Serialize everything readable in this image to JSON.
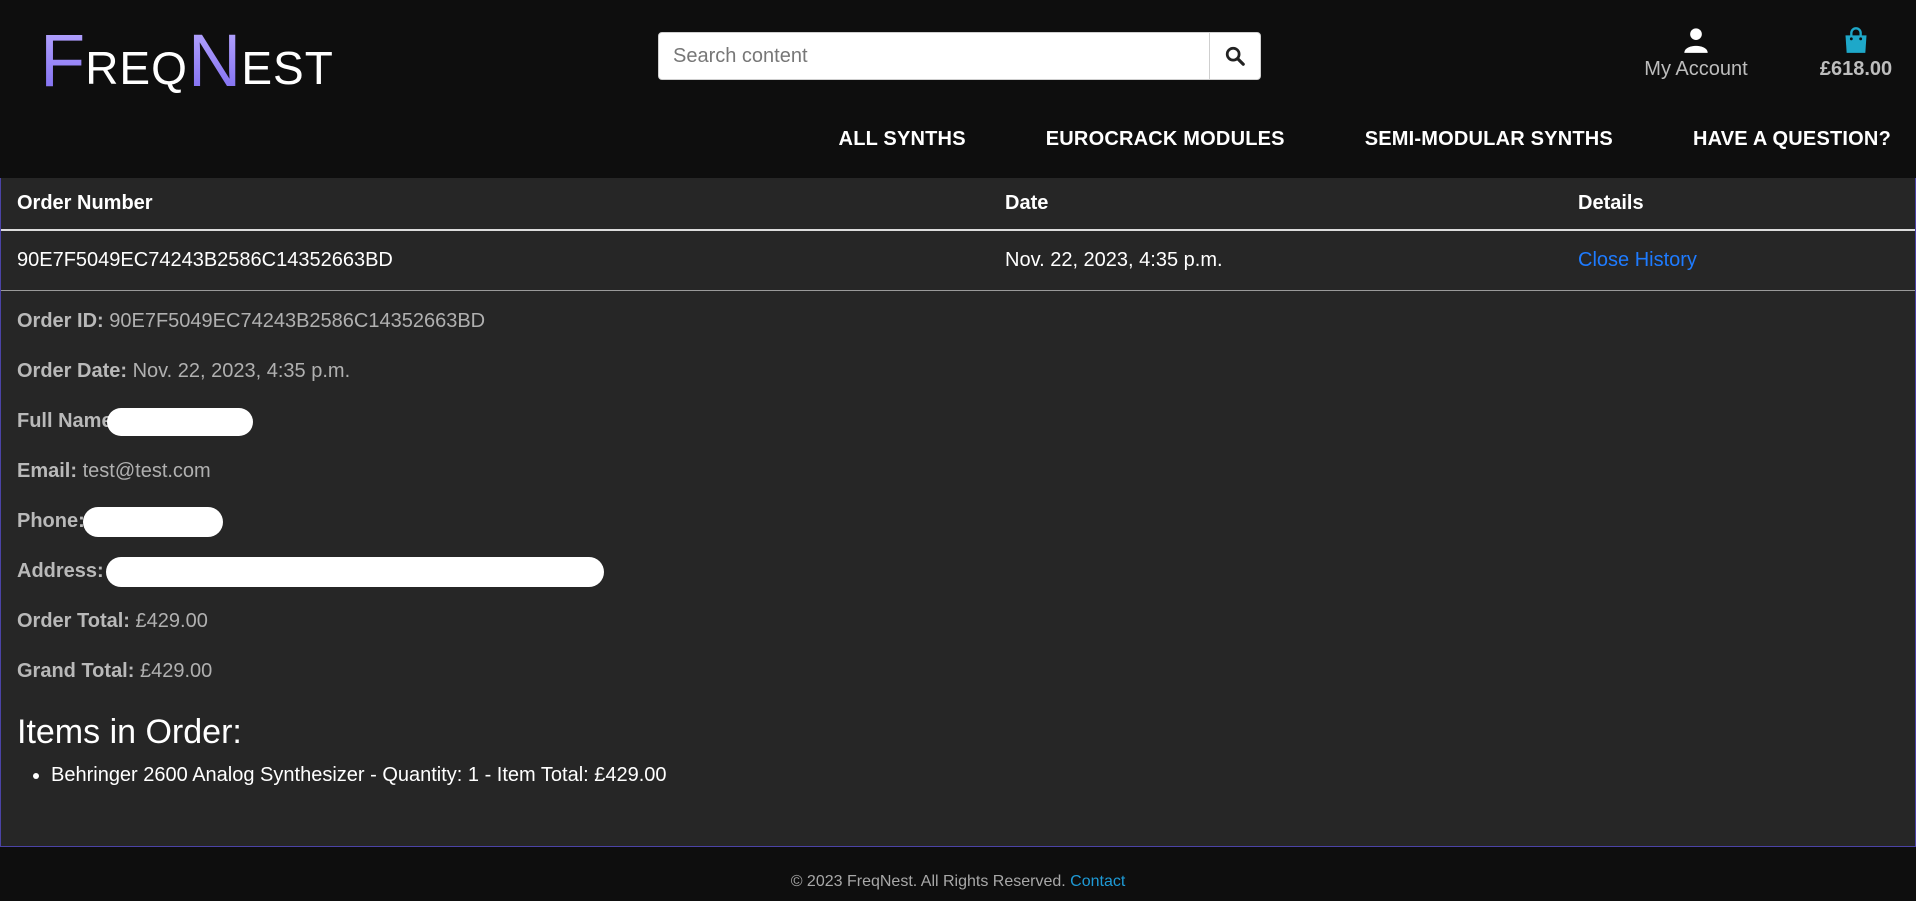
{
  "brand": {
    "logo_big_f": "F",
    "logo_small_1": "REQ",
    "logo_big_n": "N",
    "logo_small_2": "EST"
  },
  "search": {
    "placeholder": "Search content",
    "icon": "search-icon"
  },
  "account": {
    "label": "My Account",
    "icon": "user-icon"
  },
  "basket": {
    "total": "£618.00",
    "icon": "shopping-bag-icon"
  },
  "nav": {
    "items": [
      "ALL SYNTHS",
      "EUROCRACK MODULES",
      "SEMI-MODULAR SYNTHS",
      "HAVE A QUESTION?"
    ]
  },
  "table": {
    "headers": [
      "Order Number",
      "Date",
      "Details"
    ],
    "row": {
      "order_number": "90E7F5049EC74243B2586C14352663BD",
      "date": "Nov. 22, 2023, 4:35 p.m.",
      "details_link": "Close History"
    }
  },
  "details": {
    "order_id_label": "Order ID:",
    "order_id": "90E7F5049EC74243B2586C14352663BD",
    "order_date_label": "Order Date:",
    "order_date": "Nov. 22, 2023, 4:35 p.m.",
    "full_name_label": "Full Name",
    "email_label": "Email:",
    "email": "test@test.com",
    "phone_label": "Phone:",
    "address_label": "Address:",
    "order_total_label": "Order Total:",
    "order_total": "£429.00",
    "grand_total_label": "Grand Total:",
    "grand_total": "£429.00"
  },
  "items": {
    "title": "Items in Order:",
    "list": [
      "Behringer 2600 Analog Synthesizer - Quantity: 1 - Item Total: £429.00"
    ]
  },
  "footer": {
    "text": "© 2023 FreqNest. All Rights Reserved.",
    "link": "Contact"
  },
  "colors": {
    "accent_link": "#1e7bff",
    "basket_icon": "#1ea8c9",
    "card_border": "#4b43a6"
  }
}
